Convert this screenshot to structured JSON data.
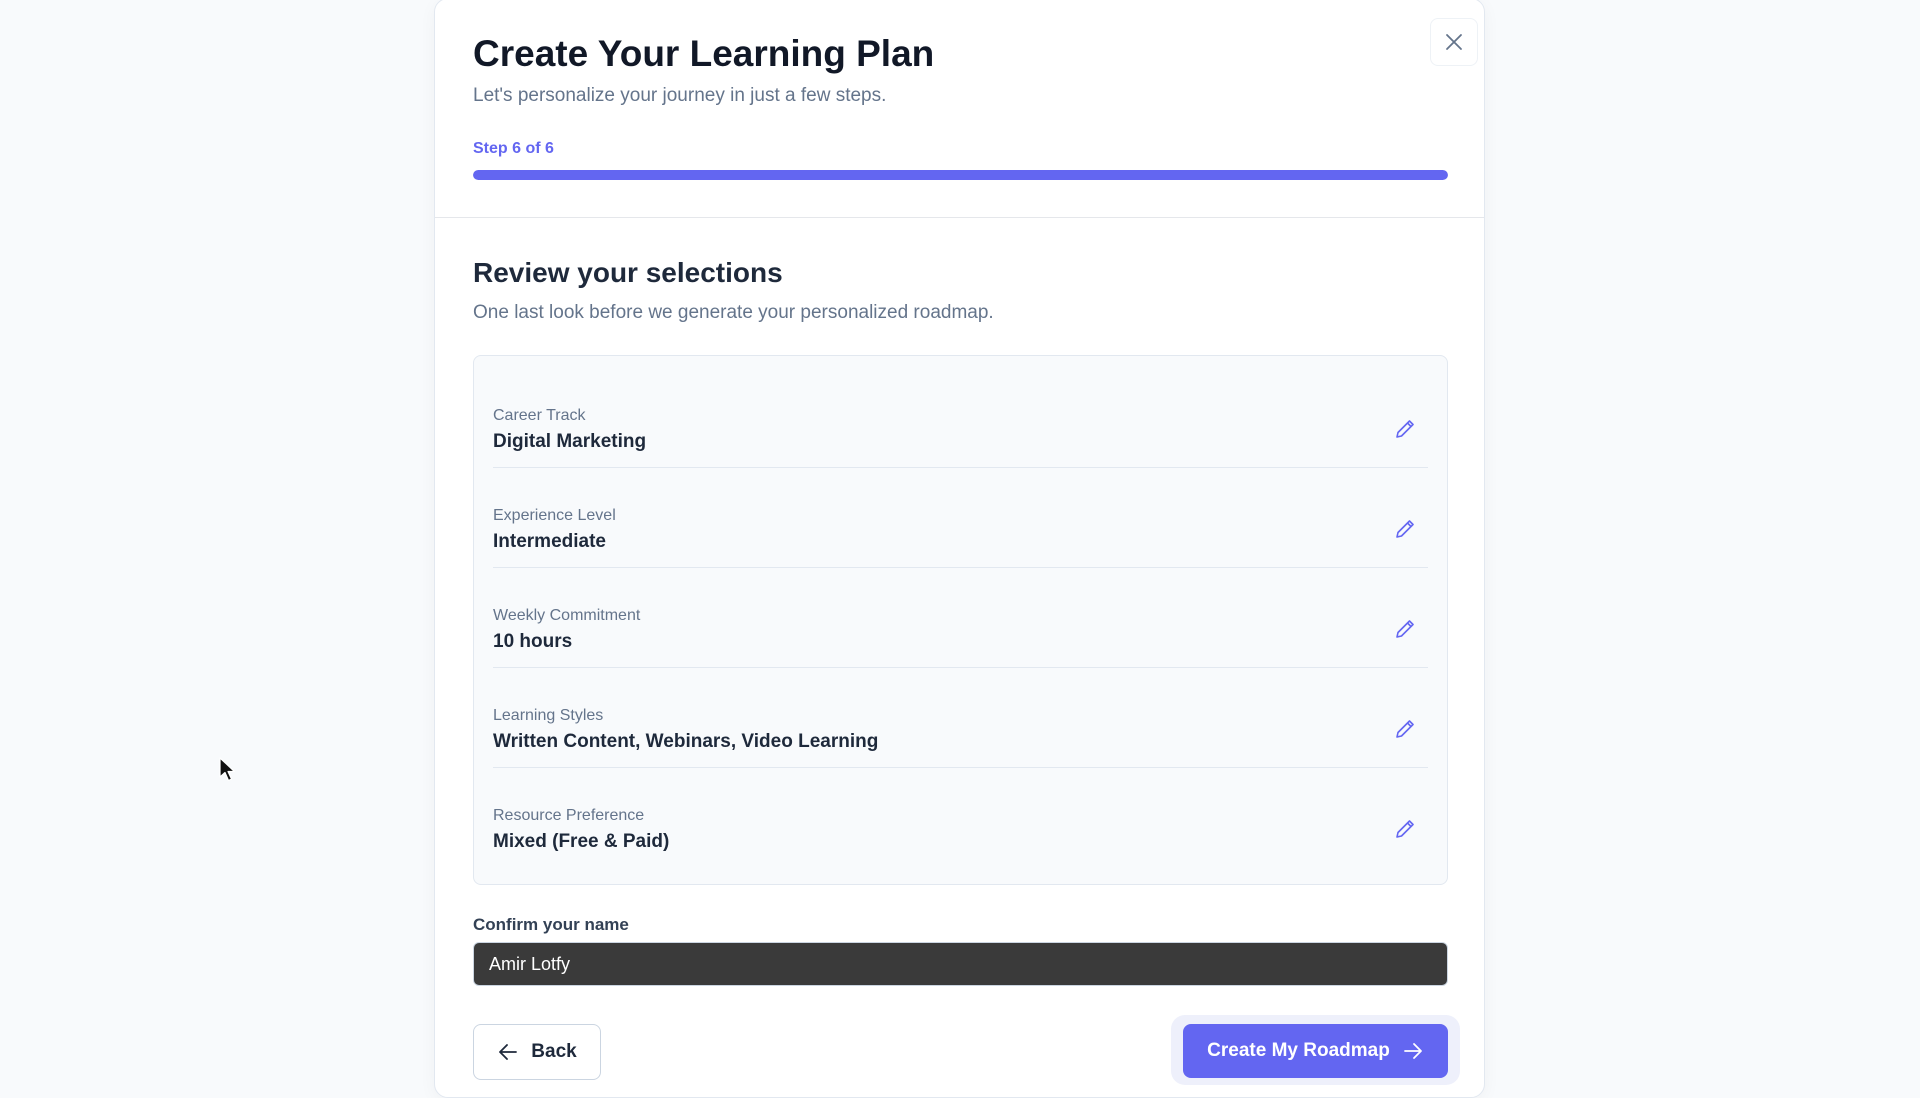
{
  "modal": {
    "title": "Create Your Learning Plan",
    "subtitle": "Let's personalize your journey in just a few steps.",
    "step_label": "Step 6 of 6",
    "progress_fraction": 1.0
  },
  "review": {
    "title": "Review your selections",
    "subtitle": "One last look before we generate your personalized roadmap.",
    "items": [
      {
        "label": "Career Track",
        "value": "Digital Marketing"
      },
      {
        "label": "Experience Level",
        "value": "Intermediate"
      },
      {
        "label": "Weekly Commitment",
        "value": "10 hours"
      },
      {
        "label": "Learning Styles",
        "value": "Written Content, Webinars, Video Learning"
      },
      {
        "label": "Resource Preference",
        "value": "Mixed (Free & Paid)"
      }
    ]
  },
  "name_field": {
    "label": "Confirm your name",
    "value": "Amir Lotfy"
  },
  "actions": {
    "back_label": "Back",
    "create_label": "Create My Roadmap"
  },
  "icons": {
    "close": "close-icon",
    "edit": "pencil-icon",
    "back": "arrow-left-icon",
    "create": "arrow-right-icon"
  },
  "colors": {
    "accent": "#6366f1",
    "background": "#f8fafc",
    "input_bg": "#3a3a3a"
  }
}
